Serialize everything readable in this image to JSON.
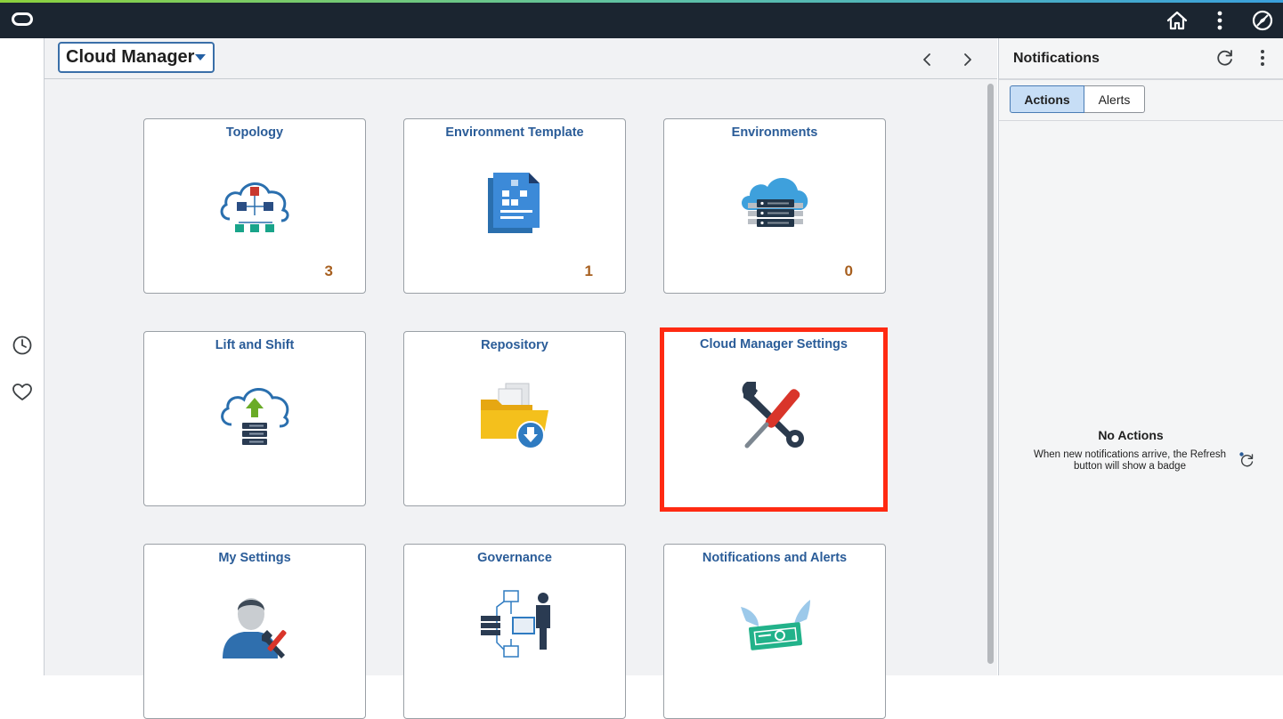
{
  "header": {
    "home_icon": "home-icon",
    "actions_icon": "more-vertical-icon",
    "navbar_icon": "compass-icon"
  },
  "left_rail": {
    "items": [
      {
        "icon": "recent-clock-icon"
      },
      {
        "icon": "favorites-heart-icon"
      }
    ]
  },
  "homepage": {
    "selector_label": "Cloud Manager",
    "prev_icon": "chevron-left-icon",
    "next_icon": "chevron-right-icon"
  },
  "tiles": [
    {
      "title": "Topology",
      "count": "3",
      "icon": "topology-cloud-icon"
    },
    {
      "title": "Environment Template",
      "count": "1",
      "icon": "document-template-icon"
    },
    {
      "title": "Environments",
      "count": "0",
      "icon": "cloud-server-icon"
    },
    {
      "title": "Lift and Shift",
      "count": "",
      "icon": "cloud-upload-icon"
    },
    {
      "title": "Repository",
      "count": "",
      "icon": "folder-download-icon"
    },
    {
      "title": "Cloud Manager Settings",
      "count": "",
      "icon": "tools-icon",
      "highlighted": true
    },
    {
      "title": "My Settings",
      "count": "",
      "icon": "user-settings-icon"
    },
    {
      "title": "Governance",
      "count": "",
      "icon": "governance-icon"
    },
    {
      "title": "Notifications and Alerts",
      "count": "",
      "icon": "winged-notification-icon"
    }
  ],
  "notifications": {
    "title": "Notifications",
    "tabs": [
      {
        "label": "Actions",
        "active": true
      },
      {
        "label": "Alerts",
        "active": false
      }
    ],
    "empty_title": "No Actions",
    "empty_message": "When new notifications arrive, the Refresh button will show a badge"
  },
  "colors": {
    "header_bg": "#1b2530",
    "tile_title": "#2a5c98",
    "count": "#a75f1f",
    "highlight": "#ff2a12"
  }
}
